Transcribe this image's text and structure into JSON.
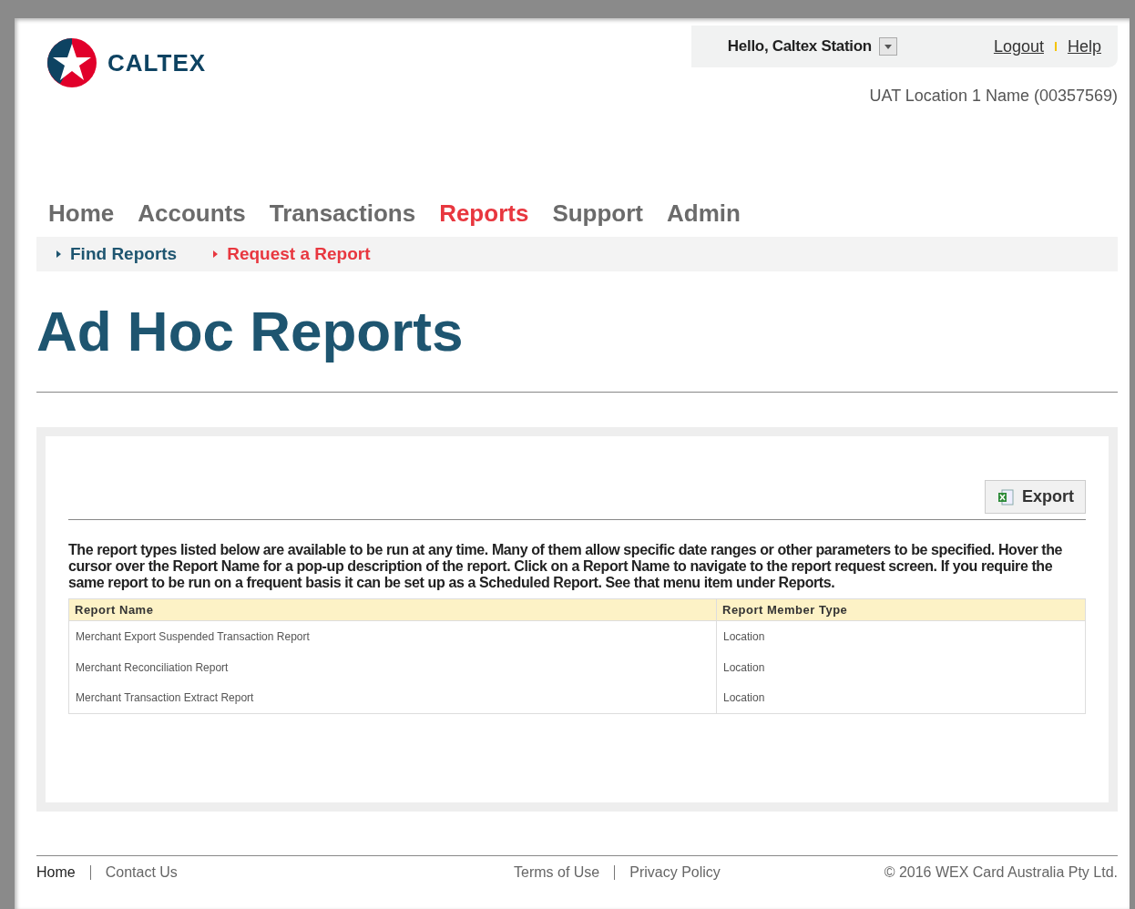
{
  "header": {
    "brand": "CALTEX",
    "greeting": "Hello, Caltex Station",
    "links": [
      "Logout",
      "Help"
    ],
    "location": "UAT Location 1 Name (00357569)"
  },
  "nav": [
    {
      "label": "Home",
      "selected": false
    },
    {
      "label": "Accounts",
      "selected": false
    },
    {
      "label": "Transactions",
      "selected": false
    },
    {
      "label": "Reports",
      "selected": true
    },
    {
      "label": "Support",
      "selected": false
    },
    {
      "label": "Admin",
      "selected": false
    }
  ],
  "subnav": [
    {
      "label": "Find Reports",
      "selected": false
    },
    {
      "label": "Request a Report",
      "selected": true
    }
  ],
  "page_title": "Ad Hoc Reports",
  "export_button": "Export",
  "intro": "The report types listed below are available to be run at any time. Many of them allow specific date ranges or other parameters to be specified. Hover the cursor over the Report Name for a pop-up description of the report. Click on a Report Name to navigate to the report request screen. If you require the same report to be run on a frequent basis it can be set up as a Scheduled Report. See that menu item under Reports.",
  "table": {
    "columns": [
      "Report Name",
      "Report Member Type"
    ],
    "rows": [
      [
        "Merchant Export Suspended Transaction Report",
        "Location"
      ],
      [
        "Merchant Reconciliation Report",
        "Location"
      ],
      [
        "Merchant Transaction Extract Report",
        "Location"
      ]
    ]
  },
  "footer": {
    "left_links": [
      {
        "label": "Home",
        "selected": true
      },
      {
        "label": "Contact Us",
        "selected": false
      }
    ],
    "middle_links": [
      "Terms of Use",
      "Privacy Policy"
    ],
    "copyright": "©  2016 WEX Card Australia Pty Ltd."
  }
}
